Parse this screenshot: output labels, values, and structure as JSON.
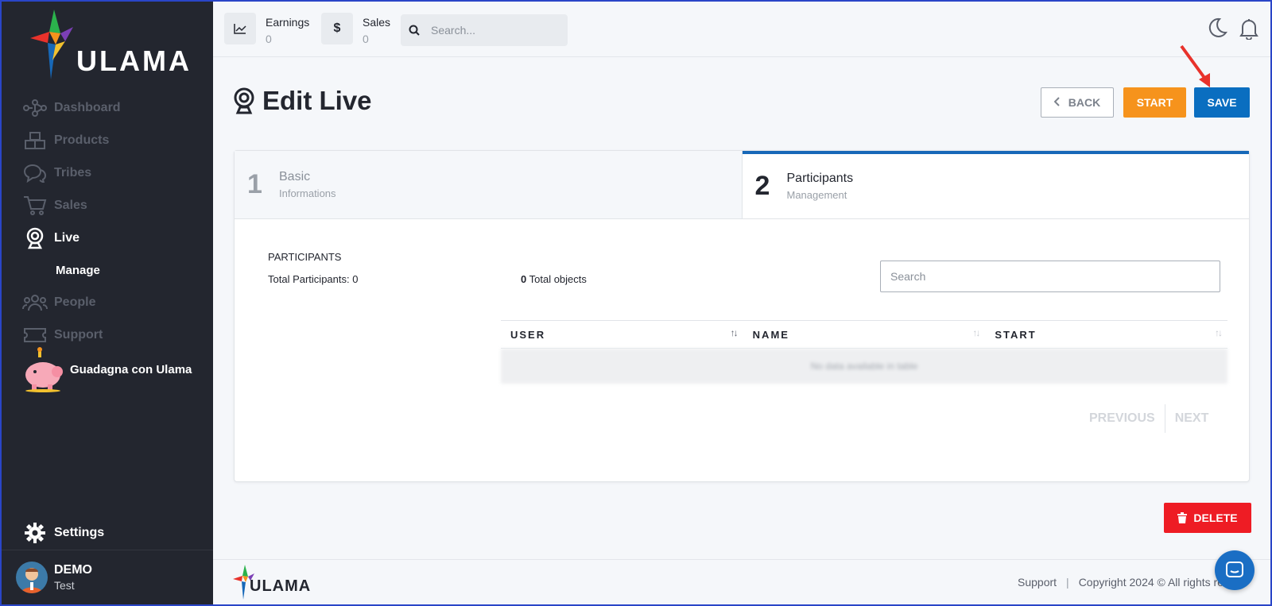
{
  "brand": {
    "name": "ULAMA"
  },
  "sidebar": {
    "items": [
      {
        "label": "Dashboard",
        "icon": "network-icon"
      },
      {
        "label": "Products",
        "icon": "boxes-icon"
      },
      {
        "label": "Tribes",
        "icon": "chat-bubbles-icon"
      },
      {
        "label": "Sales",
        "icon": "cart-icon"
      },
      {
        "label": "Live",
        "icon": "webcam-icon",
        "active": true
      },
      {
        "label": "People",
        "icon": "people-icon"
      },
      {
        "label": "Support",
        "icon": "ticket-icon"
      }
    ],
    "live_sub": "Manage",
    "earn_label": "Guadagna con Ulama",
    "settings_label": "Settings",
    "user": {
      "name": "DEMO",
      "sub": "Test"
    }
  },
  "topbar": {
    "earnings_label": "Earnings",
    "earnings_value": "0",
    "sales_label": "Sales",
    "sales_value": "0",
    "search_placeholder": "Search..."
  },
  "page": {
    "title": "Edit Live",
    "back_label": "BACK",
    "start_label": "START",
    "save_label": "SAVE",
    "delete_label": "DELETE"
  },
  "steps": [
    {
      "num": "1",
      "title": "Basic",
      "sub": "Informations",
      "active": false
    },
    {
      "num": "2",
      "title": "Participants",
      "sub": "Management",
      "active": true
    }
  ],
  "participants": {
    "heading": "PARTICIPANTS",
    "total_label": "Total Participants: 0",
    "total_objects_count": "0",
    "total_objects_text": "Total objects",
    "search_placeholder": "Search",
    "columns": [
      "USER",
      "NAME",
      "START"
    ],
    "empty_text": "No data available in table",
    "prev_label": "PREVIOUS",
    "next_label": "NEXT"
  },
  "footer": {
    "support_label": "Support",
    "separator": "|",
    "copyright": "Copyright 2024 © All rights res"
  },
  "colors": {
    "sidebar_bg": "#23262f",
    "accent_blue": "#0a6ec0",
    "start_orange": "#f6931c",
    "delete_red": "#ee1c24",
    "annotation_arrow": "#e8322b"
  }
}
